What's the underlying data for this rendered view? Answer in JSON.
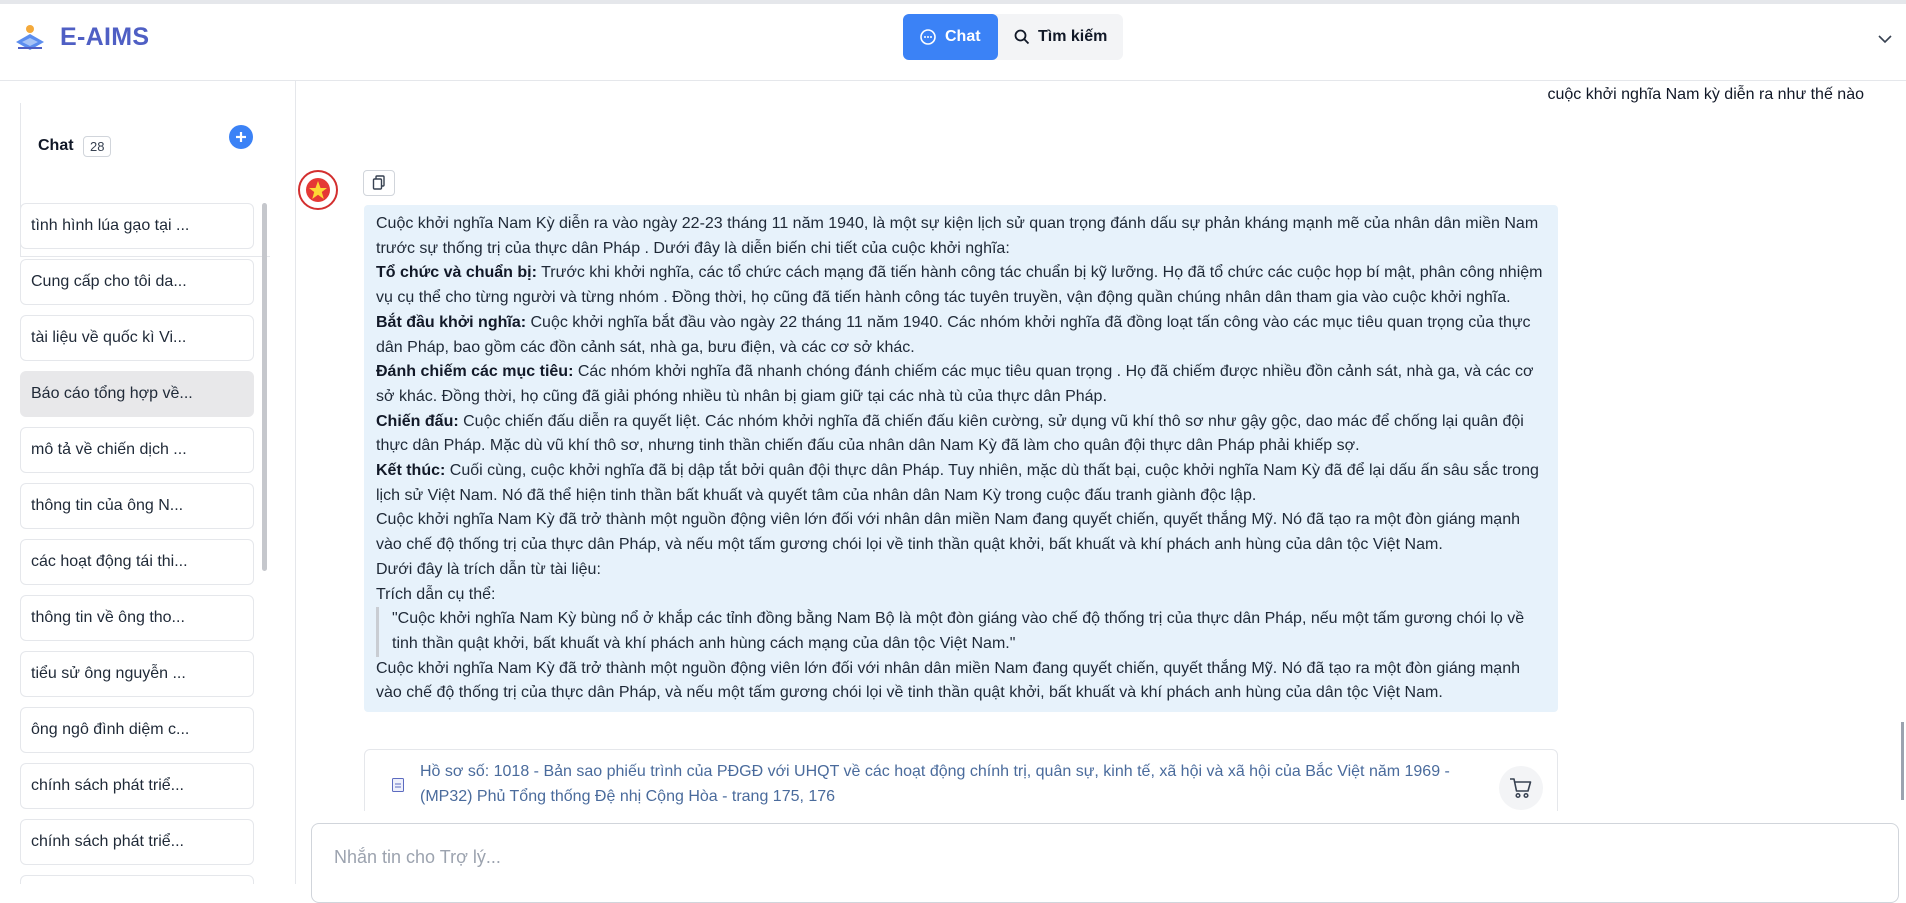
{
  "app": {
    "name": "E-AIMS",
    "brand_color": "#4f5fc4",
    "accent_color": "#3b82f6"
  },
  "header": {
    "tabs": [
      {
        "label": "Chat",
        "icon": "chat-bubble-icon",
        "active": true
      },
      {
        "label": "Tìm kiếm",
        "icon": "search-icon",
        "active": false
      }
    ],
    "collapse_icon": "chevron-down-icon"
  },
  "sidebar": {
    "title": "Chat",
    "count": "28",
    "add_icon": "plus-circle-icon",
    "items": [
      {
        "label": "tình hình lúa gạo tại ..."
      },
      {
        "label": "Cung cấp cho tôi da..."
      },
      {
        "label": "tài liệu về quốc kì Vi..."
      },
      {
        "label": "Báo cáo tổng hợp về...",
        "selected": true
      },
      {
        "label": "mô tả về chiến dịch ..."
      },
      {
        "label": "thông tin của ông N..."
      },
      {
        "label": "các hoạt động tái thi..."
      },
      {
        "label": "thông tin về ông tho..."
      },
      {
        "label": "tiểu sử ông nguyễn ..."
      },
      {
        "label": "ông ngô đình diệm c..."
      },
      {
        "label": "chính sách phát triể..."
      },
      {
        "label": "chính sách phát triể..."
      }
    ]
  },
  "conversation": {
    "user_message": "cuộc khởi nghĩa Nam kỳ diễn ra như thế nào",
    "assistant": {
      "intro": "Cuộc khởi nghĩa Nam Kỳ diễn ra vào ngày 22-23 tháng 11 năm 1940, là một sự kiện lịch sử quan trọng đánh dấu sự phản kháng mạnh mẽ của nhân dân miền Nam trước sự thống trị của thực dân Pháp . Dưới đây là diễn biến chi tiết của cuộc khởi nghĩa:",
      "sections": [
        {
          "heading": "Tổ chức và chuẩn bị:",
          "text": " Trước khi khởi nghĩa, các tổ chức cách mạng đã tiến hành công tác chuẩn bị kỹ lưỡng. Họ đã tổ chức các cuộc họp bí mật, phân công nhiệm vụ cụ thể cho từng người và từng nhóm . Đồng thời, họ cũng đã tiến hành công tác tuyên truyền, vận động quần chúng nhân dân tham gia vào cuộc khởi nghĩa."
        },
        {
          "heading": "Bắt đầu khởi nghĩa:",
          "text": " Cuộc khởi nghĩa bắt đầu vào ngày 22 tháng 11 năm 1940. Các nhóm khởi nghĩa đã đồng loạt tấn công vào các mục tiêu quan trọng của thực dân Pháp, bao gồm các đồn cảnh sát, nhà ga, bưu điện, và các cơ sở khác."
        },
        {
          "heading": "Đánh chiếm các mục tiêu:",
          "text": " Các nhóm khởi nghĩa đã nhanh chóng đánh chiếm các mục tiêu quan trọng . Họ đã chiếm được nhiều đồn cảnh sát, nhà ga, và các cơ sở khác. Đồng thời, họ cũng đã giải phóng nhiều tù nhân bị giam giữ tại các nhà tù của thực dân Pháp."
        },
        {
          "heading": "Chiến đấu:",
          "text": " Cuộc chiến đấu diễn ra quyết liệt. Các nhóm khởi nghĩa đã chiến đấu kiên cường, sử dụng vũ khí thô sơ như gậy gộc, dao mác để chống lại quân đội thực dân Pháp. Mặc dù vũ khí thô sơ, nhưng tinh thần chiến đấu của nhân dân Nam Kỳ đã làm cho quân đội thực dân Pháp phải khiếp sợ."
        },
        {
          "heading": "Kết thúc:",
          "text": " Cuối cùng, cuộc khởi nghĩa đã bị dập tắt bởi quân đội thực dân Pháp. Tuy nhiên, mặc dù thất bại, cuộc khởi nghĩa Nam Kỳ đã để lại dấu ấn sâu sắc trong lịch sử Việt Nam. Nó đã thể hiện tinh thần bất khuất và quyết tâm của nhân dân Nam Kỳ trong cuộc đấu tranh giành độc lập."
        }
      ],
      "conclusion": "Cuộc khởi nghĩa Nam Kỳ đã trở thành một nguồn động viên lớn đối với nhân dân miền Nam đang quyết chiến, quyết thắng Mỹ. Nó đã tạo ra một đòn giáng mạnh vào chế độ thống trị của thực dân Pháp, và nếu một tấm gương chói lọi về tinh thần quật khởi, bất khuất và khí phách anh hùng của dân tộc Việt Nam.",
      "citation_intro": "Dưới đây là trích dẫn từ tài liệu:",
      "citation_label": "Trích dẫn cụ thể:",
      "quote": "\"Cuộc khởi nghĩa Nam Kỳ bùng nổ ở khắp các tỉnh đồng bằng Nam Bộ là một đòn giáng vào chế độ thống trị của thực dân Pháp, nếu một tấm gương chói lọ về tinh thần quật khởi, bất khuất và khí phách anh hùng cách mạng của dân tộc Việt Nam.\"",
      "closing": "Cuộc khởi nghĩa Nam Kỳ đã trở thành một nguồn động viên lớn đối với nhân dân miền Nam đang quyết chiến, quyết thắng Mỹ. Nó đã tạo ra một đòn giáng mạnh vào chế độ thống trị của thực dân Pháp, và nếu một tấm gương chói lọi về tinh thần quật khởi, bất khuất và khí phách anh hùng của dân tộc Việt Nam."
    },
    "source": {
      "text": "Hồ sơ số: 1018 - Bản sao phiếu trình của PĐGĐ với UHQT về các hoạt động chính trị, quân sự, kinh tế, xã hội và xã hội của Bắc Việt năm 1969 - (MP32) Phủ Tổng thống Đệ nhị Cộng Hòa - trang 175, 176",
      "icon": "document-icon",
      "action_icon": "cart-icon"
    }
  },
  "composer": {
    "placeholder": "Nhắn tin cho Trợ lý...",
    "value": ""
  }
}
